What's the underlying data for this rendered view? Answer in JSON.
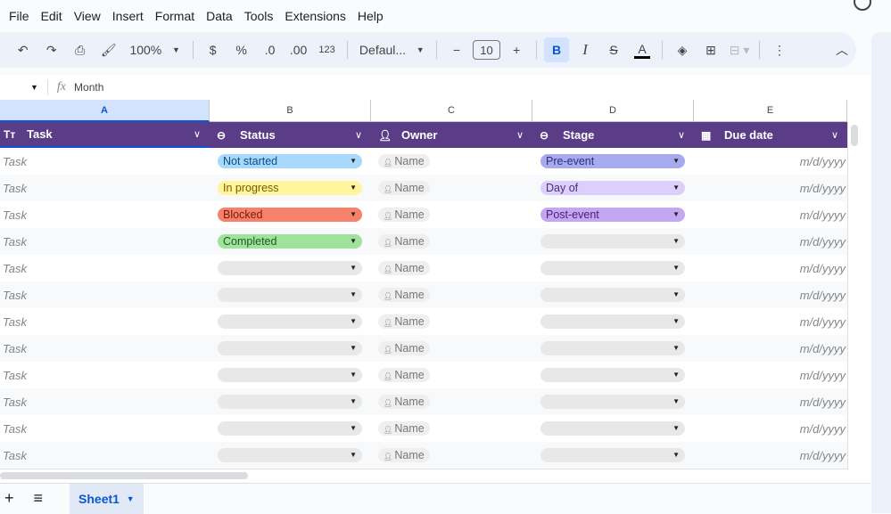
{
  "menu": [
    "File",
    "Edit",
    "View",
    "Insert",
    "Format",
    "Data",
    "Tools",
    "Extensions",
    "Help"
  ],
  "toolbar": {
    "zoom": "100%",
    "currency": "$",
    "percent": "%",
    "dec_decrease": ".0",
    "dec_increase": ".00",
    "more_formats": "123",
    "font": "Defaul...",
    "font_size": "10",
    "bold": "B",
    "italic": "I",
    "text_color": "A"
  },
  "formula_bar": {
    "fx": "fx",
    "content": "Month"
  },
  "columns": [
    "A",
    "B",
    "C",
    "D",
    "E"
  ],
  "headers": [
    {
      "label": "Task",
      "icon": "Tт"
    },
    {
      "label": "Status"
    },
    {
      "label": "Owner"
    },
    {
      "label": "Stage"
    },
    {
      "label": "Due date"
    }
  ],
  "status_colors": {
    "Not started": "#a8d8fb",
    "In progress": "#fff59d",
    "Blocked": "#f8816b",
    "Completed": "#9ee29b",
    "": "#e8e8e8"
  },
  "stage_colors": {
    "Pre-event": "#a8aaf0",
    "Day of": "#dccffb",
    "Post-event": "#c3a7f2",
    "": "#e8e8e8"
  },
  "rows": [
    {
      "task": "Task",
      "status": "Not started",
      "owner": "Name",
      "stage": "Pre-event",
      "due": "m/d/yyyy"
    },
    {
      "task": "Task",
      "status": "In progress",
      "owner": "Name",
      "stage": "Day of",
      "due": "m/d/yyyy"
    },
    {
      "task": "Task",
      "status": "Blocked",
      "owner": "Name",
      "stage": "Post-event",
      "due": "m/d/yyyy"
    },
    {
      "task": "Task",
      "status": "Completed",
      "owner": "Name",
      "stage": "",
      "due": "m/d/yyyy"
    },
    {
      "task": "Task",
      "status": "",
      "owner": "Name",
      "stage": "",
      "due": "m/d/yyyy"
    },
    {
      "task": "Task",
      "status": "",
      "owner": "Name",
      "stage": "",
      "due": "m/d/yyyy"
    },
    {
      "task": "Task",
      "status": "",
      "owner": "Name",
      "stage": "",
      "due": "m/d/yyyy"
    },
    {
      "task": "Task",
      "status": "",
      "owner": "Name",
      "stage": "",
      "due": "m/d/yyyy"
    },
    {
      "task": "Task",
      "status": "",
      "owner": "Name",
      "stage": "",
      "due": "m/d/yyyy"
    },
    {
      "task": "Task",
      "status": "",
      "owner": "Name",
      "stage": "",
      "due": "m/d/yyyy"
    },
    {
      "task": "Task",
      "status": "",
      "owner": "Name",
      "stage": "",
      "due": "m/d/yyyy"
    },
    {
      "task": "Task",
      "status": "",
      "owner": "Name",
      "stage": "",
      "due": "m/d/yyyy"
    }
  ],
  "sheet_tab": "Sheet1"
}
